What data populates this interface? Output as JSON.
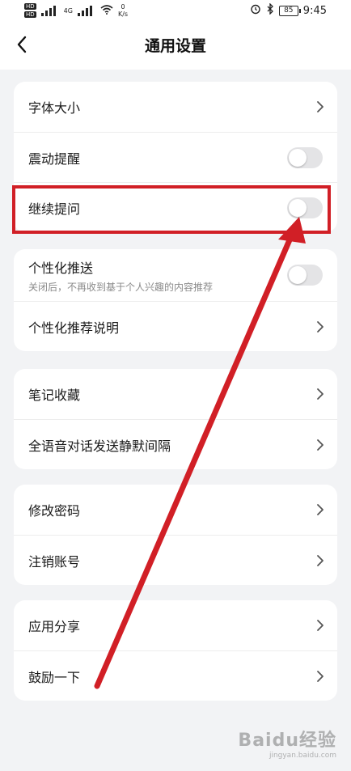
{
  "status_bar": {
    "hd_badges": [
      "HD",
      "HD"
    ],
    "network": "4G",
    "speed_value": "0",
    "speed_unit": "K/s",
    "battery": "85",
    "time": "9:45"
  },
  "header": {
    "title": "通用设置"
  },
  "groups": [
    {
      "items": [
        {
          "label": "字体大小",
          "type": "chevron"
        },
        {
          "label": "震动提醒",
          "type": "toggle",
          "on": false
        },
        {
          "label": "继续提问",
          "type": "toggle",
          "on": false
        }
      ]
    },
    {
      "items": [
        {
          "label": "个性化推送",
          "sub": "关闭后，不再收到基于个人兴趣的内容推荐",
          "type": "toggle",
          "on": false
        },
        {
          "label": "个性化推荐说明",
          "type": "chevron"
        }
      ]
    },
    {
      "items": [
        {
          "label": "笔记收藏",
          "type": "chevron"
        },
        {
          "label": "全语音对话发送静默间隔",
          "type": "chevron"
        }
      ]
    },
    {
      "items": [
        {
          "label": "修改密码",
          "type": "chevron"
        },
        {
          "label": "注销账号",
          "type": "chevron"
        }
      ]
    },
    {
      "items": [
        {
          "label": "应用分享",
          "type": "chevron"
        },
        {
          "label": "鼓励一下",
          "type": "chevron"
        }
      ]
    }
  ],
  "annotation": {
    "color": "#d11f26"
  },
  "watermark": {
    "text": "Baidu经验",
    "url": "jingyan.baidu.com"
  },
  "colors": {
    "background": "#f2f3f5",
    "card": "#ffffff",
    "toggle_off": "#e4e4e6"
  }
}
